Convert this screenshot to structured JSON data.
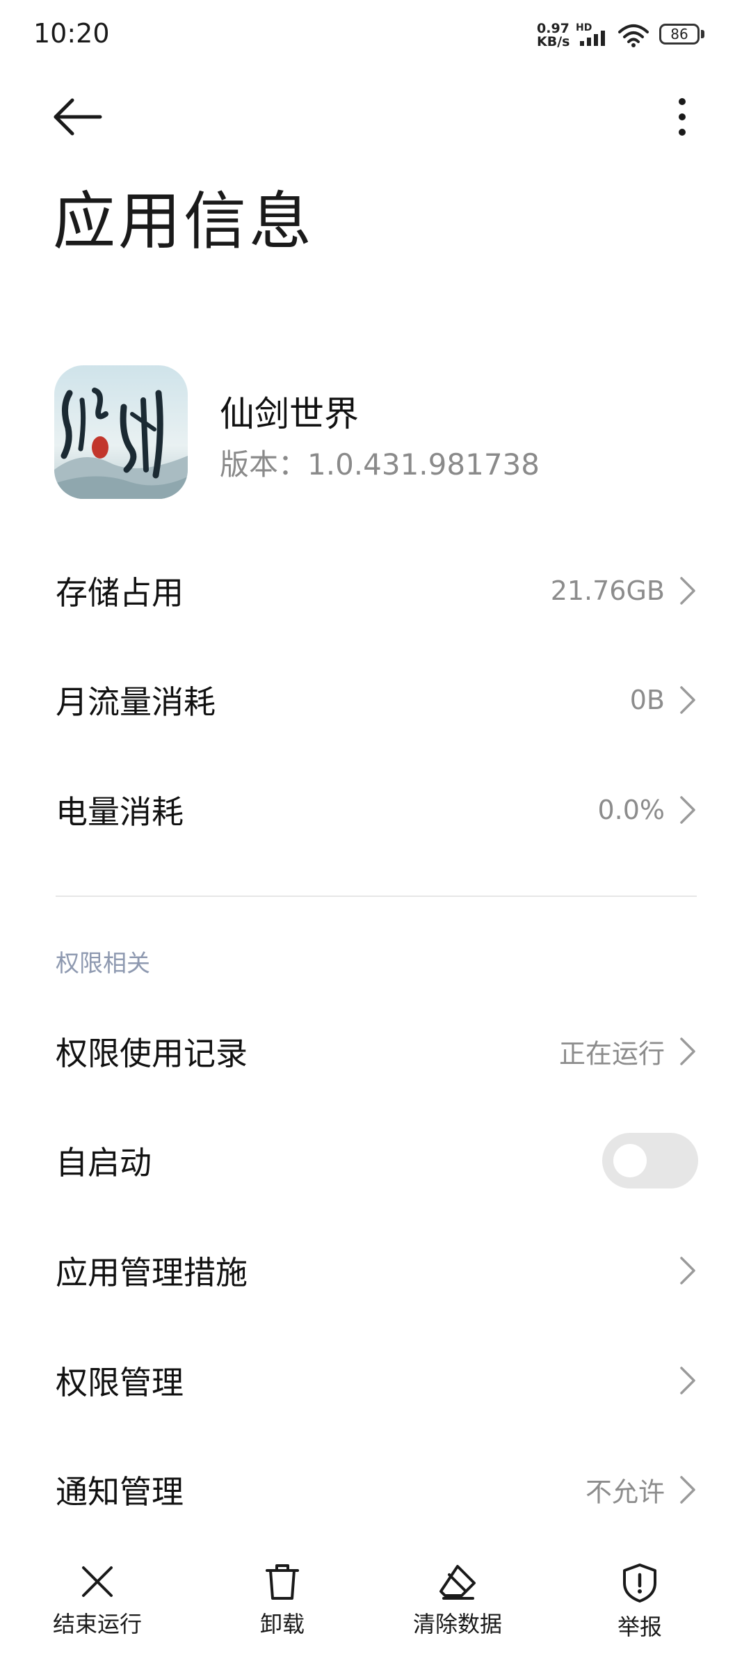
{
  "status_bar": {
    "time": "10:20",
    "net_speed_value": "0.97",
    "net_speed_unit": "KB/s",
    "hd_label": "HD",
    "battery": "86"
  },
  "header": {
    "title": "应用信息"
  },
  "app": {
    "name": "仙剑世界",
    "version_text": "版本：1.0.431.981738",
    "icon_name": "xianjian-app-icon"
  },
  "usage": [
    {
      "label": "存储占用",
      "value": "21.76GB"
    },
    {
      "label": "月流量消耗",
      "value": "0B"
    },
    {
      "label": "电量消耗",
      "value": "0.0%"
    }
  ],
  "permissions": {
    "section_title": "权限相关",
    "items": [
      {
        "label": "权限使用记录",
        "value": "正在运行"
      },
      {
        "label": "自启动",
        "toggle_on": false
      },
      {
        "label": "应用管理措施",
        "value": ""
      },
      {
        "label": "权限管理",
        "value": ""
      },
      {
        "label": "通知管理",
        "value": "不允许"
      }
    ]
  },
  "bottom_actions": [
    {
      "label": "结束运行",
      "icon": "close-icon"
    },
    {
      "label": "卸载",
      "icon": "trash-icon"
    },
    {
      "label": "清除数据",
      "icon": "eraser-icon"
    },
    {
      "label": "举报",
      "icon": "shield-alert-icon"
    }
  ],
  "colors": {
    "section_header": "#8e99b0",
    "secondary_text": "#8c8c8c",
    "toggle_off": "#e6e6e6"
  }
}
